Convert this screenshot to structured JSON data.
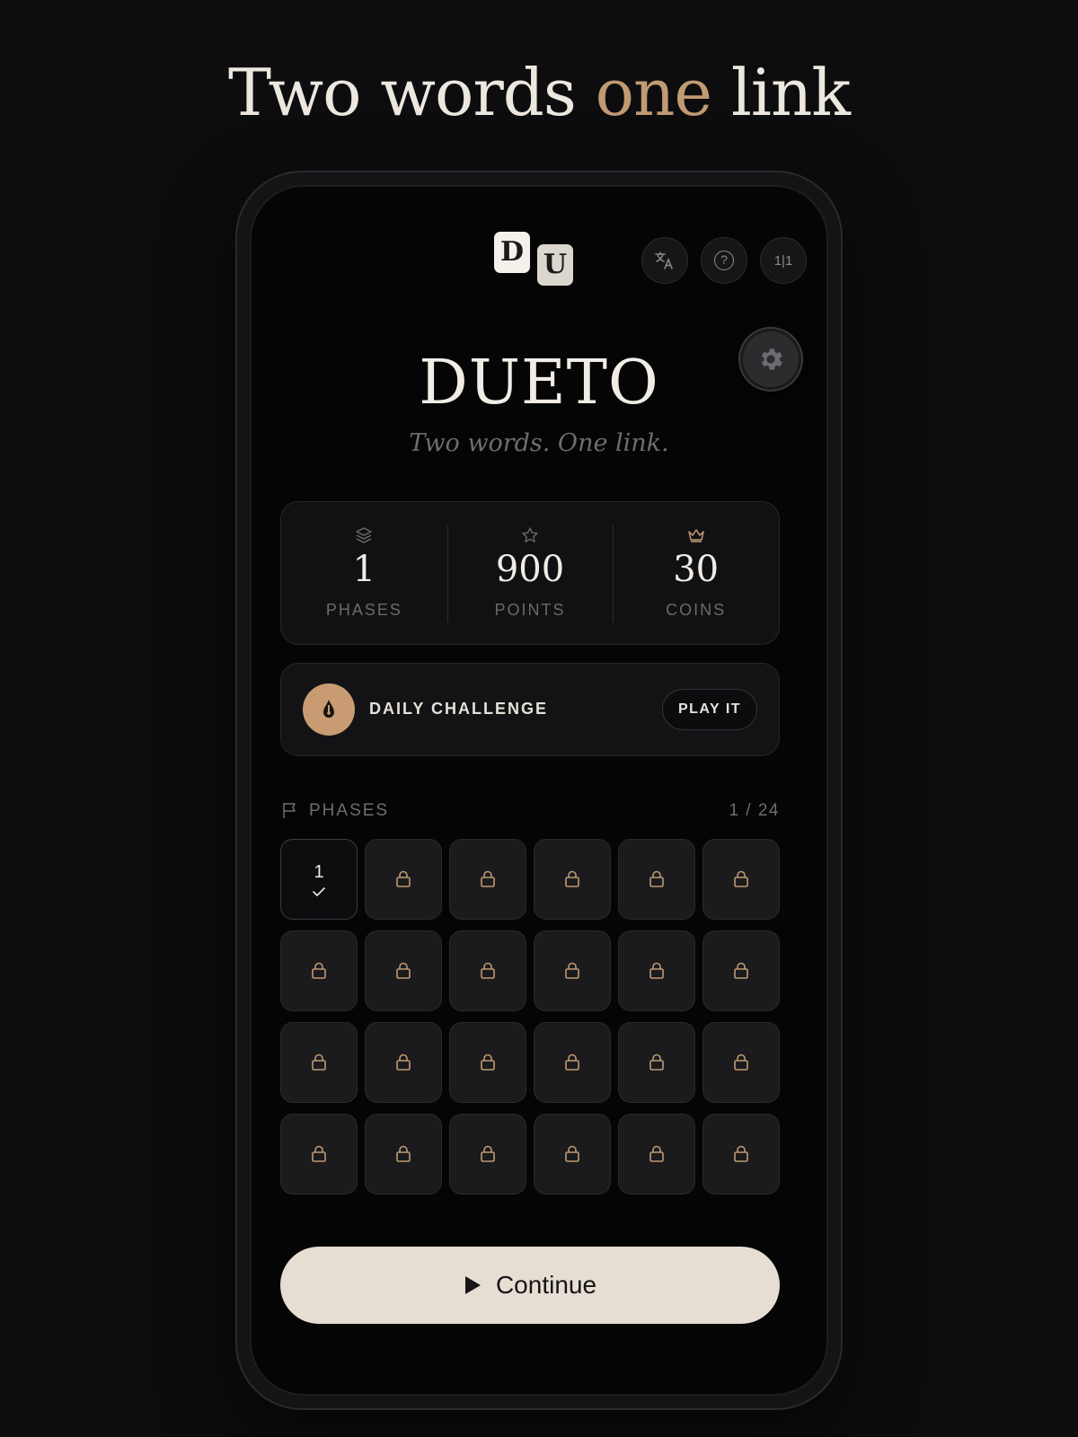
{
  "headline": {
    "part1": "Two words ",
    "accent": "one",
    "part2": " link"
  },
  "header": {
    "logo_tiles": [
      "D",
      "U"
    ],
    "translate_icon": "translate-icon",
    "help_icon": "help-icon",
    "compare_label": "1|1",
    "settings_icon": "gear-icon"
  },
  "app": {
    "title": "DUETO",
    "subtitle": "Two words. One link."
  },
  "stats": [
    {
      "icon": "layers-icon",
      "value": "1",
      "label": "PHASES"
    },
    {
      "icon": "star-icon",
      "value": "900",
      "label": "POINTS"
    },
    {
      "icon": "crown-icon",
      "value": "30",
      "label": "COINS"
    }
  ],
  "daily": {
    "icon": "pen-nib-icon",
    "label": "DAILY CHALLENGE",
    "button": "PLAY IT"
  },
  "phases": {
    "label": "PHASES",
    "count": "1 / 24",
    "completed": {
      "number": "1"
    },
    "locked_count": 23
  },
  "continue": {
    "label": "Continue"
  },
  "colors": {
    "accent": "#c09a73",
    "background": "#0d0d0f",
    "button": "#e6ddd3"
  }
}
